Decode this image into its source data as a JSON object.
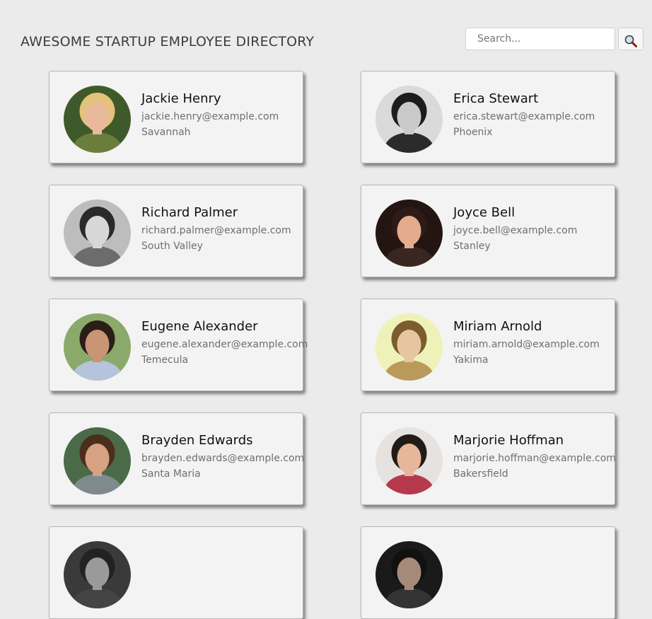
{
  "header": {
    "title": "AWESOME STARTUP EMPLOYEE DIRECTORY",
    "search_placeholder": "Search...",
    "search_button_icon": "search-icon"
  },
  "employees": [
    {
      "name": "Jackie Henry",
      "email": "jackie.henry@example.com",
      "city": "Savannah",
      "avatar": {
        "bg": "#3e5a2a",
        "skin": "#e9b99c",
        "hair": "#e3c27c",
        "shirt": "#6b7d3b"
      }
    },
    {
      "name": "Erica Stewart",
      "email": "erica.stewart@example.com",
      "city": "Phoenix",
      "avatar": {
        "bg": "#dadada",
        "skin": "#c9c9c9",
        "hair": "#1c1c1c",
        "shirt": "#2b2b2b"
      }
    },
    {
      "name": "Richard Palmer",
      "email": "richard.palmer@example.com",
      "city": "South Valley",
      "avatar": {
        "bg": "#bdbdbd",
        "skin": "#d7d7d7",
        "hair": "#2a2a2a",
        "shirt": "#6c6c6c"
      }
    },
    {
      "name": "Joyce Bell",
      "email": "joyce.bell@example.com",
      "city": "Stanley",
      "avatar": {
        "bg": "#231512",
        "skin": "#e4ab8c",
        "hair": "#2e1a17",
        "shirt": "#3a2620"
      }
    },
    {
      "name": "Eugene Alexander",
      "email": "eugene.alexander@example.com",
      "city": "Temecula",
      "avatar": {
        "bg": "#8aa96a",
        "skin": "#c99574",
        "hair": "#2a1e18",
        "shirt": "#b5c3dc"
      }
    },
    {
      "name": "Miriam Arnold",
      "email": "miriam.arnold@example.com",
      "city": "Yakima",
      "avatar": {
        "bg": "#eef2b8",
        "skin": "#e5c6a0",
        "hair": "#7c5c2c",
        "shirt": "#b99a5a"
      }
    },
    {
      "name": "Brayden Edwards",
      "email": "brayden.edwards@example.com",
      "city": "Santa Maria",
      "avatar": {
        "bg": "#4b6a48",
        "skin": "#d6a283",
        "hair": "#4a2f1c",
        "shirt": "#7f8a8d"
      }
    },
    {
      "name": "Marjorie Hoffman",
      "email": "marjorie.hoffman@example.com",
      "city": "Bakersfield",
      "avatar": {
        "bg": "#e6e2e0",
        "skin": "#e7b79b",
        "hair": "#231b18",
        "shirt": "#b63a4d"
      }
    },
    {
      "name": "",
      "email": "",
      "city": "",
      "avatar": {
        "bg": "#3a3a3a",
        "skin": "#9a9a9a",
        "hair": "#222222",
        "shirt": "#444444"
      }
    },
    {
      "name": "",
      "email": "",
      "city": "",
      "avatar": {
        "bg": "#1a1a1a",
        "skin": "#a58a7a",
        "hair": "#111111",
        "shirt": "#333333"
      }
    }
  ]
}
